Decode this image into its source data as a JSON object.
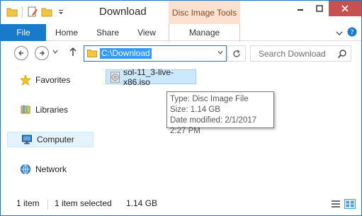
{
  "window": {
    "title": "Download",
    "context_tab_title": "Disc Image Tools"
  },
  "ribbon": {
    "tabs": [
      {
        "label": "File"
      },
      {
        "label": "Home"
      },
      {
        "label": "Share"
      },
      {
        "label": "View"
      },
      {
        "label": "Manage"
      }
    ]
  },
  "address": {
    "path": "C:\\Download",
    "search_placeholder": "Search Download"
  },
  "nav_pane": {
    "items": [
      {
        "label": "Favorites",
        "icon": "star-icon"
      },
      {
        "label": "Libraries",
        "icon": "libraries-icon"
      },
      {
        "label": "Computer",
        "icon": "computer-icon",
        "selected": true
      },
      {
        "label": "Network",
        "icon": "network-icon"
      }
    ]
  },
  "files": [
    {
      "name": "sol-11_3-live-x86.iso",
      "icon": "disc-image-icon",
      "selected": true
    }
  ],
  "tooltip": {
    "type": "Type: Disc Image File",
    "size": "Size: 1.14 GB",
    "modified": "Date modified: 2/1/2017 2:27 PM"
  },
  "status_bar": {
    "item_count": "1 item",
    "selection": "1 item selected",
    "selection_size": "1.14 GB"
  },
  "colors": {
    "accent": "#1979ca",
    "context_tab": "#fce0d0",
    "selection": "#cce8ff",
    "address_highlight": "#3399ff",
    "close_button": "#c75050"
  }
}
